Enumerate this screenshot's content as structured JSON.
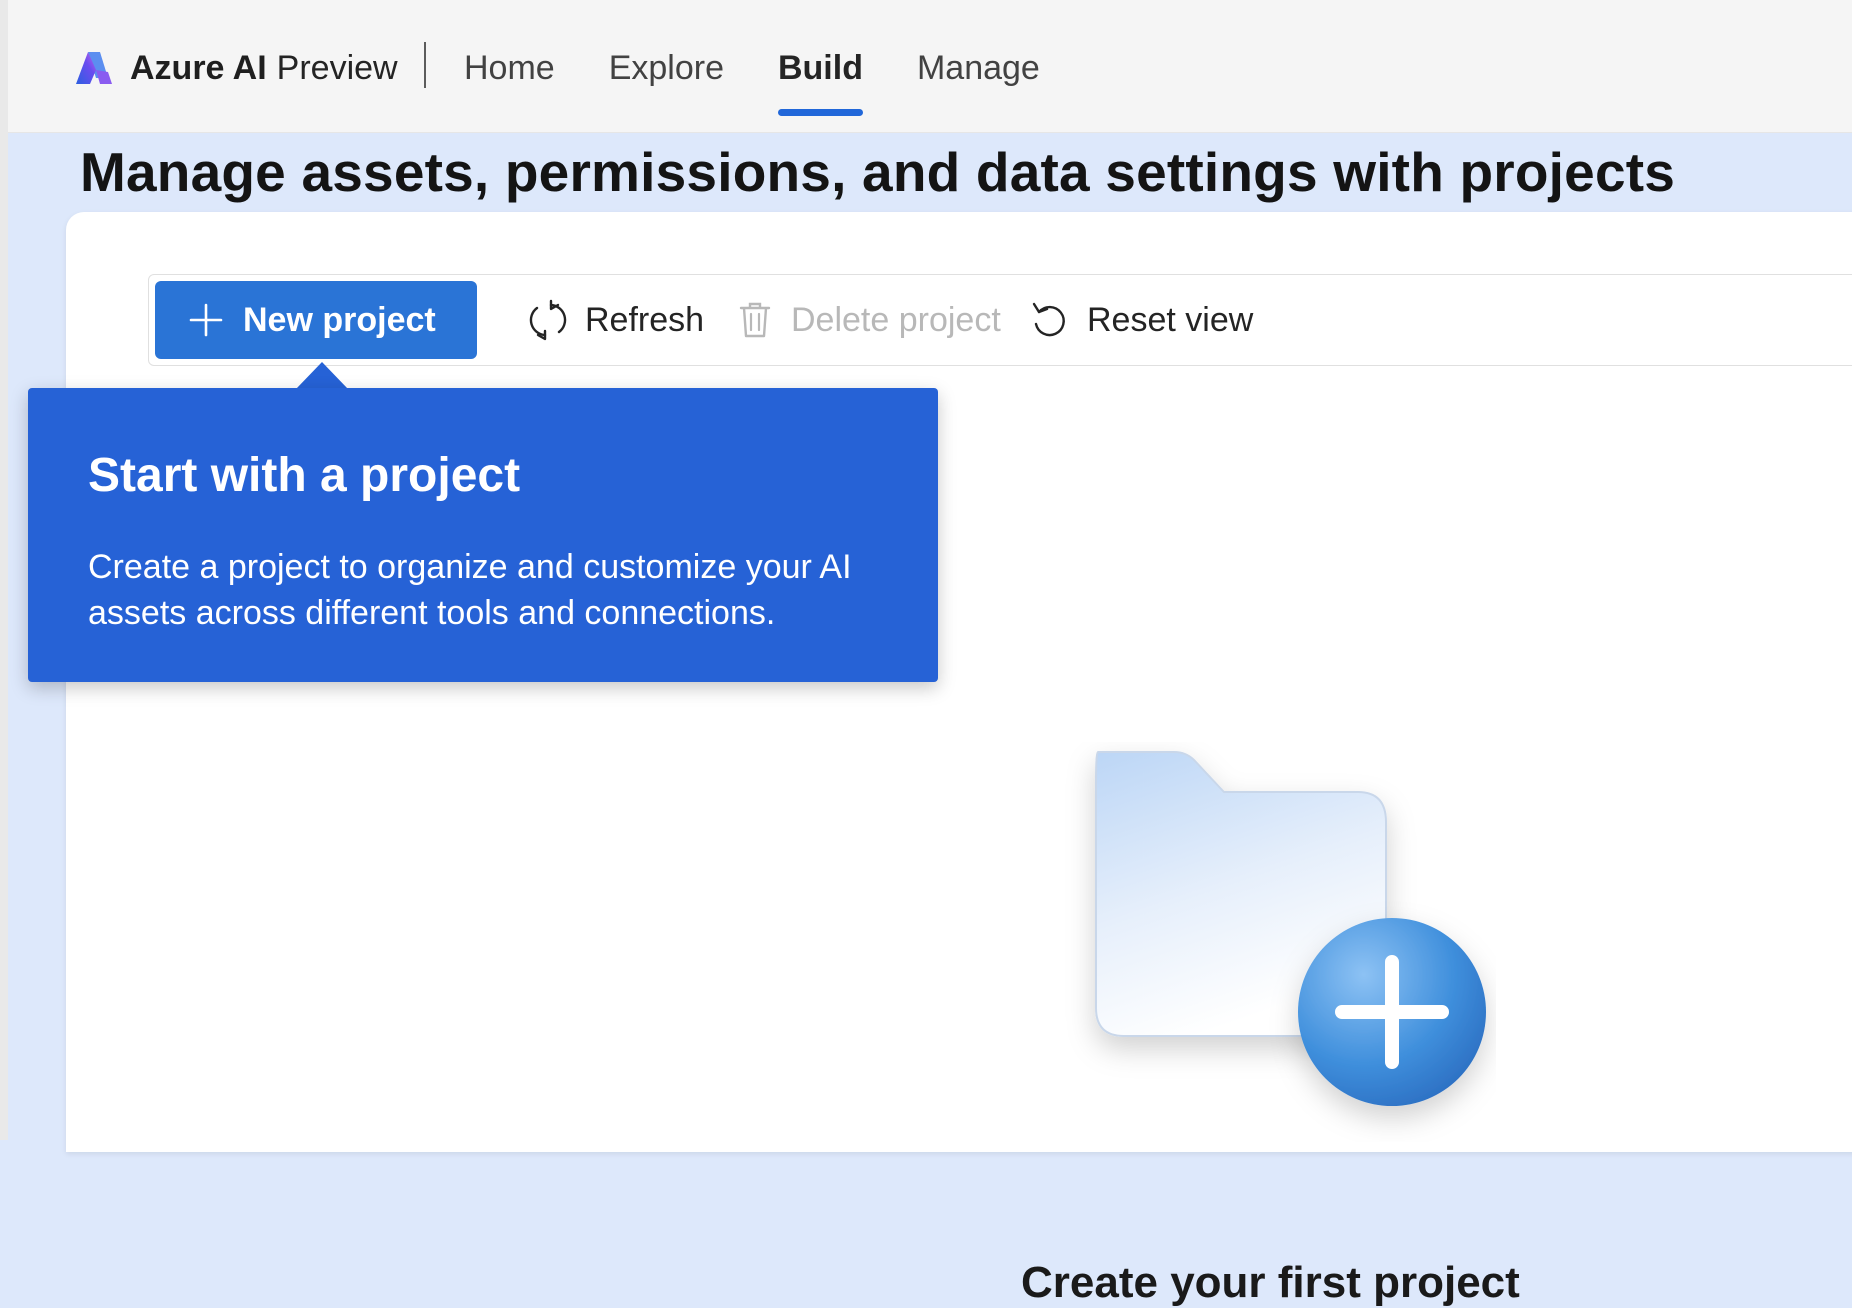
{
  "header": {
    "brand_name": "Azure AI",
    "brand_suffix": "Preview",
    "nav": [
      {
        "label": "Home",
        "active": false
      },
      {
        "label": "Explore",
        "active": false
      },
      {
        "label": "Build",
        "active": true
      },
      {
        "label": "Manage",
        "active": false
      }
    ]
  },
  "page": {
    "title": "Manage assets, permissions, and data settings with projects"
  },
  "toolbar": {
    "new_project": {
      "label": "New project",
      "icon": "plus-icon"
    },
    "refresh": {
      "label": "Refresh",
      "icon": "refresh-icon"
    },
    "delete_project": {
      "label": "Delete project",
      "icon": "trash-icon",
      "disabled": true
    },
    "reset_view": {
      "label": "Reset view",
      "icon": "undo-icon"
    }
  },
  "callout": {
    "title": "Start with a project",
    "body": "Create a project to organize and customize your AI assets across different tools and connections."
  },
  "empty_state": {
    "title": "Create your first project",
    "icon": "folder-add-illustration"
  },
  "colors": {
    "accent": "#2a74d6",
    "callout_bg": "#2662d6",
    "nav_active_underline": "#2167d9",
    "page_bg": "#dde8fb"
  }
}
